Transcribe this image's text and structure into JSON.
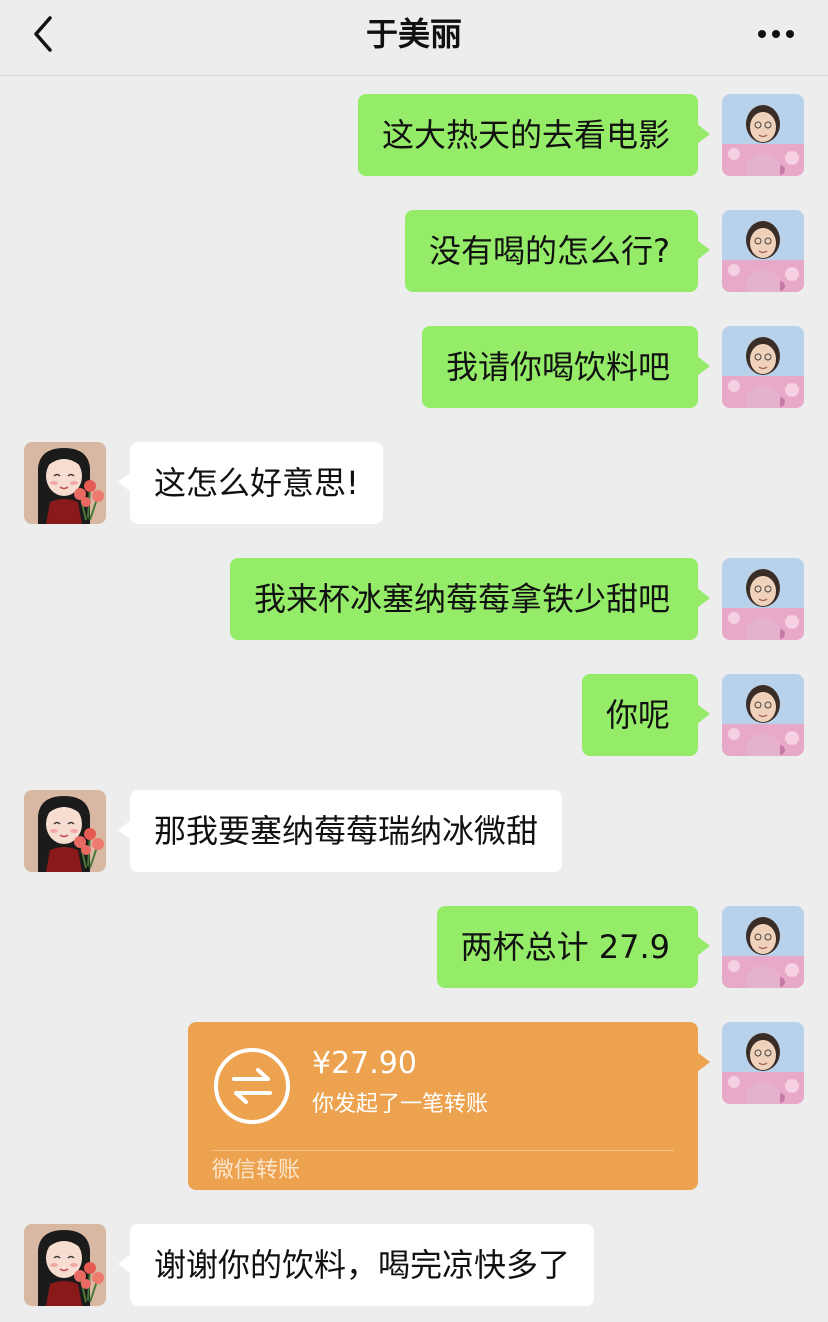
{
  "header": {
    "title": "于美丽"
  },
  "icons": {
    "back": "back-chevron-icon",
    "more": "more-icon",
    "transfer": "transfer-arrows-icon"
  },
  "colors": {
    "outgoing_bubble": "#95ec69",
    "incoming_bubble": "#ffffff",
    "transfer_card": "#eda250",
    "background": "#ededed"
  },
  "messages": [
    {
      "sender": "me",
      "text": "这大热天的去看电影"
    },
    {
      "sender": "me",
      "text": "没有喝的怎么行?"
    },
    {
      "sender": "me",
      "text": "我请你喝饮料吧"
    },
    {
      "sender": "other",
      "text": "这怎么好意思!"
    },
    {
      "sender": "me",
      "text": "我来杯冰塞纳莓莓拿铁少甜吧"
    },
    {
      "sender": "me",
      "text": "你呢"
    },
    {
      "sender": "other",
      "text": "那我要塞纳莓莓瑞纳冰微甜"
    },
    {
      "sender": "me",
      "text": "两杯总计 27.9"
    },
    {
      "sender": "other",
      "text": "谢谢你的饮料，喝完凉快多了"
    }
  ],
  "transfer": {
    "amount": "¥27.90",
    "note": "你发起了一笔转账",
    "label": "微信转账"
  }
}
